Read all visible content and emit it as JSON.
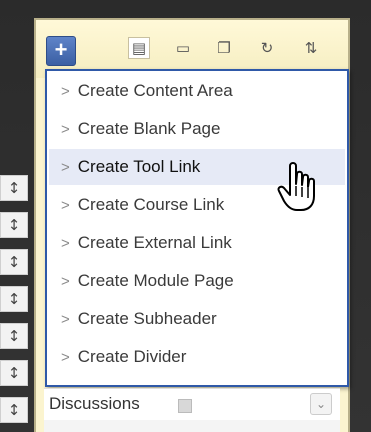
{
  "toolbar": {
    "add_symbol": "+",
    "icons": [
      {
        "name": "list-view-icon",
        "glyph": "▤"
      },
      {
        "name": "folder-icon",
        "glyph": "▭"
      },
      {
        "name": "windows-icon",
        "glyph": "❐"
      },
      {
        "name": "refresh-icon",
        "glyph": "↻"
      },
      {
        "name": "sort-icon",
        "glyph": "⇅"
      }
    ]
  },
  "dropdown": {
    "chevron": ">",
    "items": [
      {
        "label": "Create Content Area"
      },
      {
        "label": "Create Blank Page"
      },
      {
        "label": "Create Tool Link"
      },
      {
        "label": "Create Course Link"
      },
      {
        "label": "Create External Link"
      },
      {
        "label": "Create Module Page"
      },
      {
        "label": "Create Subheader"
      },
      {
        "label": "Create Divider"
      }
    ],
    "highlighted": "Create Tool Link"
  },
  "course_menu": {
    "discussions_label": "Discussions",
    "handle_glyph": "↕"
  },
  "colors": {
    "accent": "#2f59a8",
    "panel": "#fbf4cf",
    "highlight": "#e6eaf6"
  }
}
